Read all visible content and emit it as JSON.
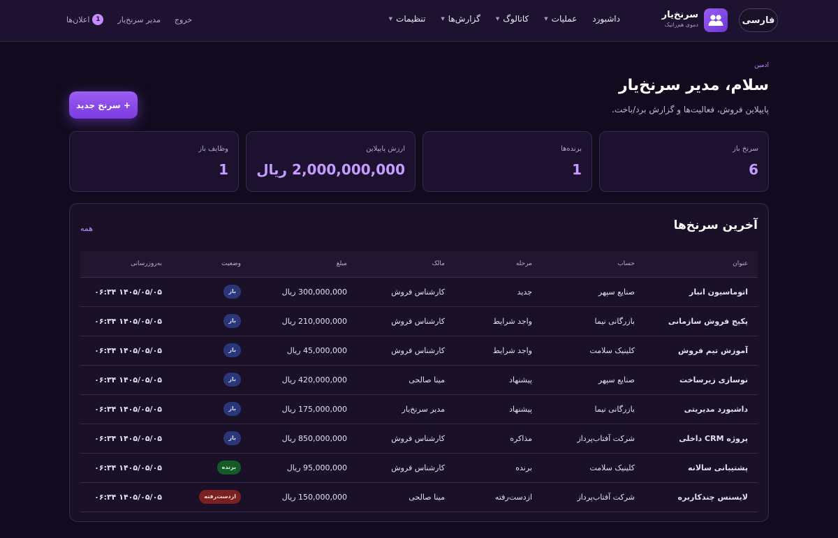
{
  "header": {
    "lang_label": "فارسی",
    "brand_name": "سرنخ‌یار",
    "brand_sub": "دموی هم‌راتیک",
    "nav": [
      {
        "label": "داشبورد",
        "has_caret": false
      },
      {
        "label": "عملیات",
        "has_caret": true
      },
      {
        "label": "کاتالوگ",
        "has_caret": true
      },
      {
        "label": "گزارش‌ها",
        "has_caret": true
      },
      {
        "label": "تنظیمات",
        "has_caret": true
      }
    ],
    "notifications_label": "اعلان‌ها",
    "notifications_count": "1",
    "user_name": "مدیر سرنخ‌یار",
    "logout_label": "خروج"
  },
  "page": {
    "role": "ادمین",
    "title": "سلام، مدیر سرنخ‌یار",
    "subtitle": "پایپلاین فروش، فعالیت‌ها و گزارش برد/باخت.",
    "new_lead_button": "+ سرنخ جدید"
  },
  "stats": [
    {
      "label": "سرنخ باز",
      "value": "6"
    },
    {
      "label": "برنده‌ها",
      "value": "1"
    },
    {
      "label": "ارزش پایپلاین",
      "value": "2,000,000,000 ریال"
    },
    {
      "label": "وظایف باز",
      "value": "1"
    }
  ],
  "deals": {
    "title": "آخرین سرنخ‌ها",
    "all_link": "همه",
    "columns": [
      "عنوان",
      "حساب",
      "مرحله",
      "مالک",
      "مبلغ",
      "وضعیت",
      "به‌روزرسانی"
    ],
    "rows": [
      {
        "title": "اتوماسیون انبار",
        "account": "صنایع سپهر",
        "stage": "جدید",
        "owner": "کارشناس فروش",
        "amount": "300,000,000 ریال",
        "status": "باز",
        "status_type": "open",
        "updated": "۱۴۰۵/۰۵/۰۵ ۰۶:۳۴"
      },
      {
        "title": "پکیج فروش سازمانی",
        "account": "بازرگانی نیما",
        "stage": "واجد شرایط",
        "owner": "کارشناس فروش",
        "amount": "210,000,000 ریال",
        "status": "باز",
        "status_type": "open",
        "updated": "۱۴۰۵/۰۵/۰۵ ۰۶:۳۴"
      },
      {
        "title": "آموزش تیم فروش",
        "account": "کلینیک سلامت",
        "stage": "واجد شرایط",
        "owner": "کارشناس فروش",
        "amount": "45,000,000 ریال",
        "status": "باز",
        "status_type": "open",
        "updated": "۱۴۰۵/۰۵/۰۵ ۰۶:۳۴"
      },
      {
        "title": "نوسازی زیرساخت",
        "account": "صنایع سپهر",
        "stage": "پیشنهاد",
        "owner": "مینا صالحی",
        "amount": "420,000,000 ریال",
        "status": "باز",
        "status_type": "open",
        "updated": "۱۴۰۵/۰۵/۰۵ ۰۶:۳۴"
      },
      {
        "title": "داشبورد مدیریتی",
        "account": "بازرگانی نیما",
        "stage": "پیشنهاد",
        "owner": "مدیر سرنخ‌یار",
        "amount": "175,000,000 ریال",
        "status": "باز",
        "status_type": "open",
        "updated": "۱۴۰۵/۰۵/۰۵ ۰۶:۳۴"
      },
      {
        "title": "پروژه CRM داخلی",
        "account": "شرکت آفتاب‌پرداز",
        "stage": "مذاکره",
        "owner": "کارشناس فروش",
        "amount": "850,000,000 ریال",
        "status": "باز",
        "status_type": "open",
        "updated": "۱۴۰۵/۰۵/۰۵ ۰۶:۳۴"
      },
      {
        "title": "پشتیبانی سالانه",
        "account": "کلینیک سلامت",
        "stage": "برنده",
        "owner": "کارشناس فروش",
        "amount": "95,000,000 ریال",
        "status": "برنده",
        "status_type": "won",
        "updated": "۱۴۰۵/۰۵/۰۵ ۰۶:۳۴"
      },
      {
        "title": "لایسنس چندکاربره",
        "account": "شرکت آفتاب‌پرداز",
        "stage": "ازدست‌رفته",
        "owner": "مینا صالحی",
        "amount": "150,000,000 ریال",
        "status": "ازدست‌رفته",
        "status_type": "lost",
        "updated": "۱۴۰۵/۰۵/۰۵ ۰۶:۳۴"
      }
    ]
  },
  "icons": {
    "brand": "users-icon",
    "caret": "chevron-down-icon"
  },
  "colors": {
    "accent": "#c594ff",
    "open": "#2b3679",
    "won": "#175a2a",
    "lost": "#7a1f22"
  }
}
